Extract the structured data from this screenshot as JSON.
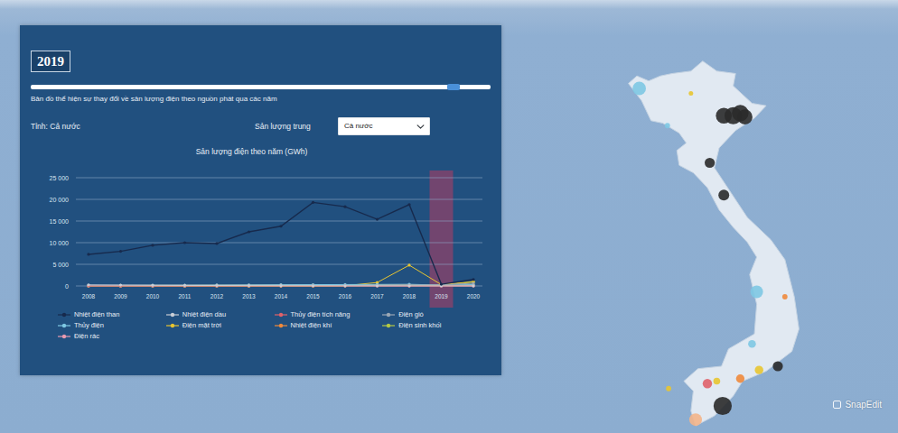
{
  "panel": {
    "year": "2019",
    "slider": {
      "level": 0.92
    },
    "description": "Bản đồ thể hiện sự thay đổi về sản lượng điện theo nguồn phát qua các năm",
    "region_label": "Tỉnh: Cả nước",
    "filter_label": "Sản lượng trung",
    "filter_value": "Cả nước"
  },
  "chart": {
    "title": "Sản lượng điện theo năm (GWh)",
    "y_max": 25000,
    "y_ticks": [
      "25 000",
      "20 000",
      "15 000",
      "10 000",
      "5 000",
      "0"
    ],
    "x_ticks": [
      {
        "label": "2008",
        "selected": false
      },
      {
        "label": "2009",
        "selected": false
      },
      {
        "label": "2010",
        "selected": false
      },
      {
        "label": "2011",
        "selected": false
      },
      {
        "label": "2012",
        "selected": false
      },
      {
        "label": "2013",
        "selected": false
      },
      {
        "label": "2014",
        "selected": false
      },
      {
        "label": "2015",
        "selected": false
      },
      {
        "label": "2016",
        "selected": false
      },
      {
        "label": "2017",
        "selected": false
      },
      {
        "label": "2018",
        "selected": false
      },
      {
        "label": "2019",
        "selected": true
      },
      {
        "label": "2020",
        "selected": false
      }
    ],
    "series": [
      {
        "name": "Nhiệt điện than",
        "color": "#172a4d",
        "values": [
          7300,
          8000,
          9400,
          10000,
          9800,
          12500,
          13800,
          19300,
          18300,
          15400,
          18800,
          400,
          1500
        ]
      },
      {
        "name": "Nhiệt điện dầu",
        "color": "#c9ced6",
        "values": [
          250,
          200,
          150,
          120,
          100,
          80,
          60,
          50,
          40,
          30,
          30,
          20,
          20
        ]
      },
      {
        "name": "Thủy điện tích năng",
        "color": "#e0626a",
        "values": [
          0,
          0,
          0,
          0,
          0,
          0,
          0,
          0,
          0,
          0,
          0,
          0,
          0
        ]
      },
      {
        "name": "Điện gió",
        "color": "#9aa7b5",
        "values": [
          0,
          0,
          0,
          10,
          20,
          30,
          40,
          50,
          80,
          100,
          200,
          300,
          600
        ]
      },
      {
        "name": "Thủy điện",
        "color": "#7ec8e3",
        "values": [
          120,
          150,
          180,
          200,
          220,
          250,
          280,
          300,
          320,
          350,
          380,
          200,
          300
        ]
      },
      {
        "name": "Điện mặt trời",
        "color": "#e8c531",
        "values": [
          0,
          0,
          0,
          0,
          0,
          0,
          0,
          0,
          50,
          800,
          4800,
          300,
          1000
        ]
      },
      {
        "name": "Nhiệt điện khí",
        "color": "#f08a3c",
        "values": [
          100,
          120,
          140,
          160,
          180,
          200,
          220,
          240,
          260,
          280,
          300,
          150,
          200
        ]
      },
      {
        "name": "Điện sinh khối",
        "color": "#b5c943",
        "values": [
          0,
          0,
          0,
          0,
          10,
          20,
          30,
          40,
          60,
          80,
          120,
          200,
          900
        ]
      },
      {
        "name": "Điện rác",
        "color": "#e89ab0",
        "values": [
          0,
          0,
          0,
          0,
          0,
          0,
          0,
          5,
          10,
          15,
          20,
          25,
          30
        ]
      }
    ]
  },
  "map": {
    "plants": [
      {
        "lat": 22.2,
        "lon": 102.6,
        "color": "#7ec8e3",
        "level": 0.6
      },
      {
        "lat": 21.1,
        "lon": 106.2,
        "color": "#2a2a2a",
        "level": 0.75
      },
      {
        "lat": 21.1,
        "lon": 106.6,
        "color": "#2a2a2a",
        "level": 0.85
      },
      {
        "lat": 21.2,
        "lon": 106.9,
        "color": "#2a2a2a",
        "level": 0.8
      },
      {
        "lat": 21.05,
        "lon": 107.1,
        "color": "#2a2a2a",
        "level": 0.7
      },
      {
        "lat": 22.0,
        "lon": 104.8,
        "color": "#e8c531",
        "level": 0.05
      },
      {
        "lat": 20.7,
        "lon": 103.8,
        "color": "#7ec8e3",
        "level": 0.1
      },
      {
        "lat": 19.2,
        "lon": 105.6,
        "color": "#2a2a2a",
        "level": 0.4
      },
      {
        "lat": 17.9,
        "lon": 106.2,
        "color": "#2a2a2a",
        "level": 0.45
      },
      {
        "lat": 14.0,
        "lon": 107.6,
        "color": "#7ec8e3",
        "level": 0.55
      },
      {
        "lat": 13.8,
        "lon": 108.8,
        "color": "#f08a3c",
        "level": 0.1
      },
      {
        "lat": 11.9,
        "lon": 107.4,
        "color": "#7ec8e3",
        "level": 0.25
      },
      {
        "lat": 11.0,
        "lon": 108.5,
        "color": "#2a2a2a",
        "level": 0.4
      },
      {
        "lat": 10.85,
        "lon": 107.7,
        "color": "#e8c531",
        "level": 0.3
      },
      {
        "lat": 10.5,
        "lon": 106.9,
        "color": "#f08a3c",
        "level": 0.3
      },
      {
        "lat": 10.3,
        "lon": 105.5,
        "color": "#e0626a",
        "level": 0.35
      },
      {
        "lat": 10.4,
        "lon": 105.9,
        "color": "#e8c531",
        "level": 0.2
      },
      {
        "lat": 9.4,
        "lon": 106.15,
        "color": "#2a2a2a",
        "level": 0.9
      },
      {
        "lat": 8.85,
        "lon": 105.0,
        "color": "#f4b58a",
        "level": 0.55
      },
      {
        "lat": 10.1,
        "lon": 103.85,
        "color": "#e8c531",
        "level": 0.1
      }
    ]
  },
  "watermark": {
    "text": "SnapEdit"
  }
}
